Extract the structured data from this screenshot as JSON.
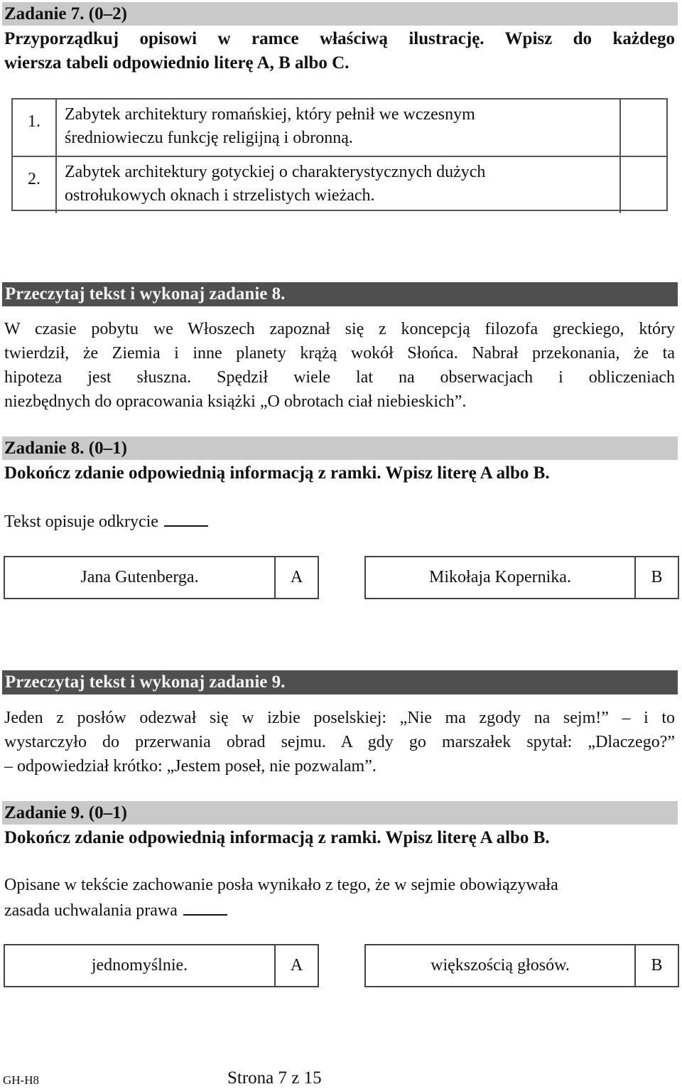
{
  "task7": {
    "header": "Zadanie 7. (0–2)",
    "instruction_lines": [
      "Przyporządkuj opisowi w ramce właściwą ilustrację. Wpisz do każdego",
      "wiersza tabeli odpowiednio literę A, B albo C."
    ],
    "rows": [
      {
        "number": "1.",
        "description_lines": [
          "Zabytek architektury romańskiej, który pełnił we wczesnym",
          "średniowieczu funkcję religijną i obronną."
        ],
        "answer": ""
      },
      {
        "number": "2.",
        "description_lines": [
          "Zabytek architektury gotyckiej o charakterystycznych dużych",
          "ostrołukowych oknach i strzelistych wieżach."
        ],
        "answer": ""
      }
    ]
  },
  "reading8": {
    "header": "Przeczytaj tekst i wykonaj zadanie 8.",
    "lines": [
      "W czasie pobytu we Włoszech zapoznał się z koncepcją filozofa greckiego, który",
      "twierdził, że Ziemia i inne planety krążą wokół Słońca. Nabrał przekonania, że ta",
      "hipoteza jest słuszna. Spędził wiele lat na obserwacjach i obliczeniach",
      "niezbędnych do opracowania książki „O obrotach ciał niebieskich”."
    ]
  },
  "task8": {
    "header": "Zadanie 8. (0–1)",
    "instruction": "Dokończ zdanie odpowiednią informacją z ramki. Wpisz literę A albo B.",
    "sentence": "Tekst opisuje odkrycie",
    "answer": "",
    "options": [
      {
        "text": "Jana Gutenberga.",
        "letter": "A"
      },
      {
        "text": "Mikołaja Kopernika.",
        "letter": "B"
      }
    ]
  },
  "reading9": {
    "header": "Przeczytaj tekst i wykonaj zadanie 9.",
    "lines": [
      "Jeden z posłów odezwał się w izbie poselskiej: „Nie ma zgody na sejm!” – i to",
      "wystarczyło do przerwania obrad sejmu. A gdy go marszałek spytał: „Dlaczego?”",
      "– odpowiedział krótko: „Jestem poseł, nie pozwalam”."
    ]
  },
  "task9": {
    "header": "Zadanie 9. (0–1)",
    "instruction": "Dokończ zdanie odpowiednią informacją z ramki. Wpisz literę A albo B.",
    "sentence_lines": [
      "Opisane w tekście zachowanie posła wynikało z tego, że w sejmie obowiązywała",
      "zasada uchwalania prawa"
    ],
    "answer": "",
    "options": [
      {
        "text": "jednomyślnie.",
        "letter": "A"
      },
      {
        "text": "większością głosów.",
        "letter": "B"
      }
    ]
  },
  "footer": {
    "code": "GH-H8",
    "page": "Strona 7 z 15"
  }
}
